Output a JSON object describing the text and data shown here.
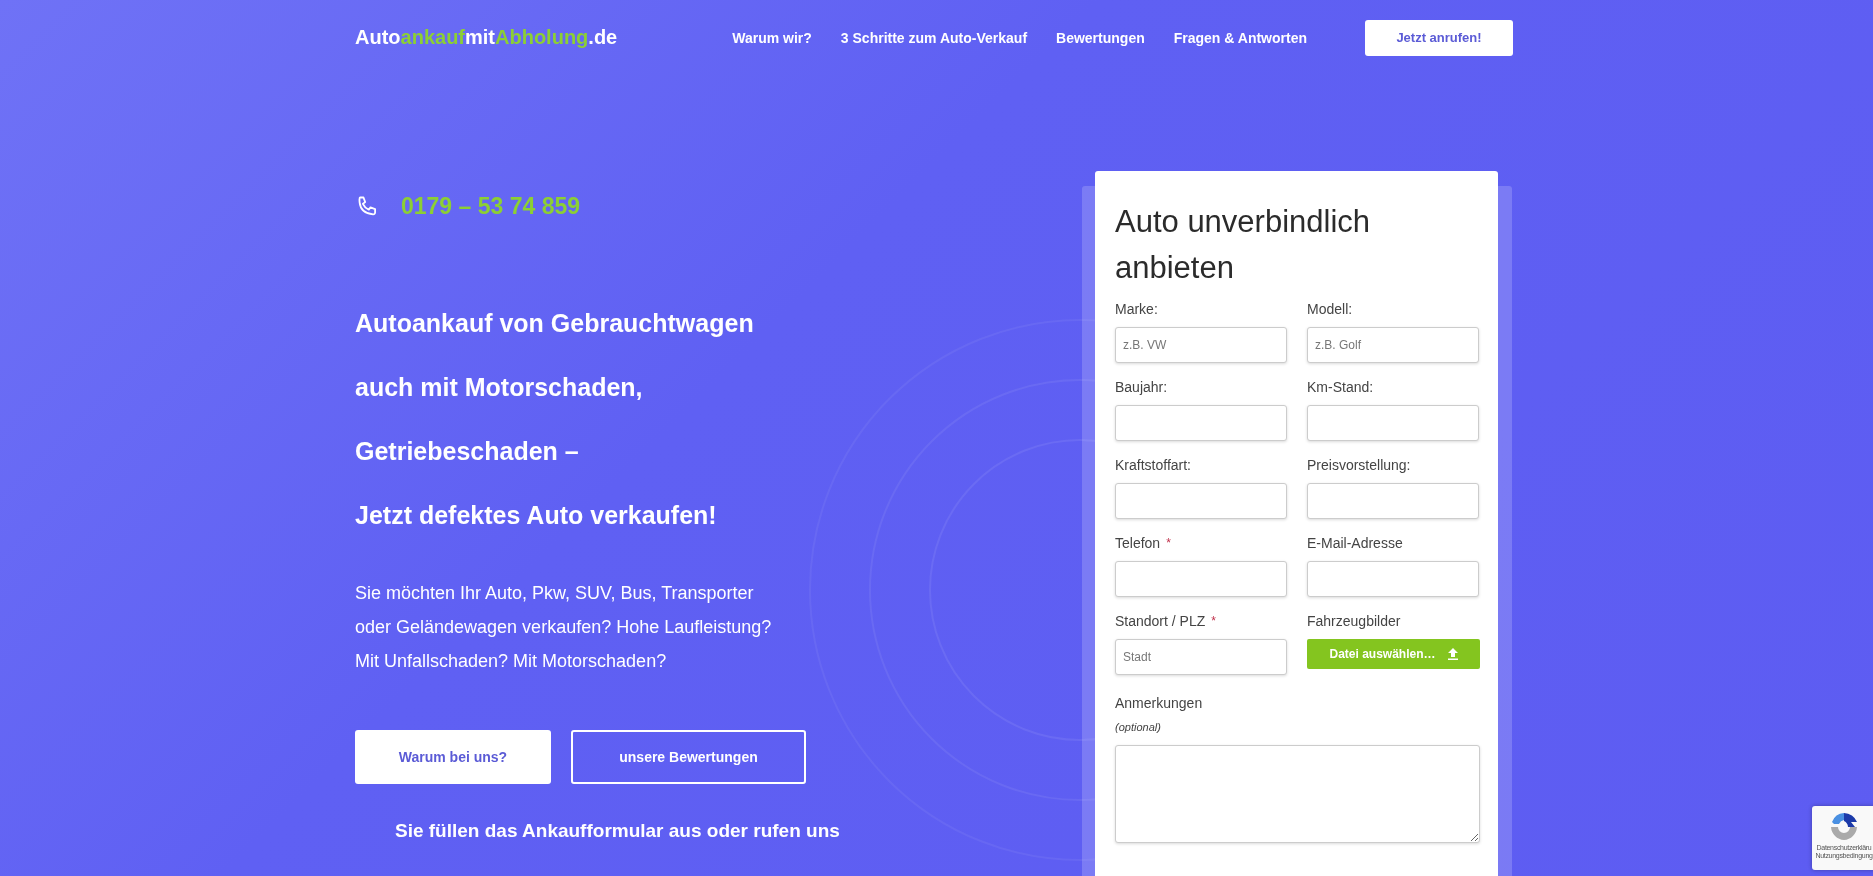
{
  "header": {
    "logo": [
      {
        "text": "Auto",
        "accent": false
      },
      {
        "text": "ankauf",
        "accent": true
      },
      {
        "text": "mit",
        "accent": false
      },
      {
        "text": "Abholung",
        "accent": true
      },
      {
        "text": ".de",
        "accent": false
      }
    ],
    "nav": [
      "Warum wir?",
      "3 Schritte zum Auto-Verkauf",
      "Bewertungen",
      "Fragen & Antworten"
    ],
    "call_button": "Jetzt anrufen!"
  },
  "hero": {
    "phone": "0179 – 53 74 859",
    "headline": [
      "Autoankauf von Gebrauchtwagen",
      "auch mit Motorschaden,",
      "Getriebeschaden –",
      "Jetzt defektes Auto verkaufen!"
    ],
    "intro": "Sie möchten Ihr Auto, Pkw, SUV, Bus, Transporter oder Geländewagen verkaufen? Hohe Laufleistung? Mit Unfallschaden? Mit Motorschaden?",
    "buttons": [
      {
        "label": "Warum bei uns?",
        "kind": "filled"
      },
      {
        "label": "unsere Bewertungen",
        "kind": "outline"
      }
    ],
    "step_text": "Sie füllen das Ankaufformular aus oder rufen uns"
  },
  "form": {
    "title": "Auto unverbindlich anbieten",
    "fields": [
      {
        "label": "Marke:",
        "kind": "input",
        "placeholder": "z.B. VW"
      },
      {
        "label": "Modell:",
        "kind": "input",
        "placeholder": "z.B. Golf"
      },
      {
        "label": "Baujahr:",
        "kind": "input"
      },
      {
        "label": "Km-Stand:",
        "kind": "input"
      },
      {
        "label": "Kraftstoffart:",
        "kind": "input"
      },
      {
        "label": "Preisvorstellung:",
        "kind": "input"
      },
      {
        "label": "Telefon",
        "kind": "input",
        "required_mark": "*"
      },
      {
        "label": "E-Mail-Adresse",
        "kind": "input"
      },
      {
        "label": "Standort / PLZ",
        "kind": "input",
        "placeholder": "Stadt",
        "required_mark": "*"
      },
      {
        "label": "Fahrzeugbilder",
        "kind": "upload",
        "button": "Datei auswählen…"
      }
    ],
    "notes": {
      "label": "Anmerkungen",
      "hint": "(optional)"
    }
  },
  "recaptcha": {
    "links": [
      "Datenschutzerkläru",
      "Nutzungsbedingung"
    ]
  }
}
